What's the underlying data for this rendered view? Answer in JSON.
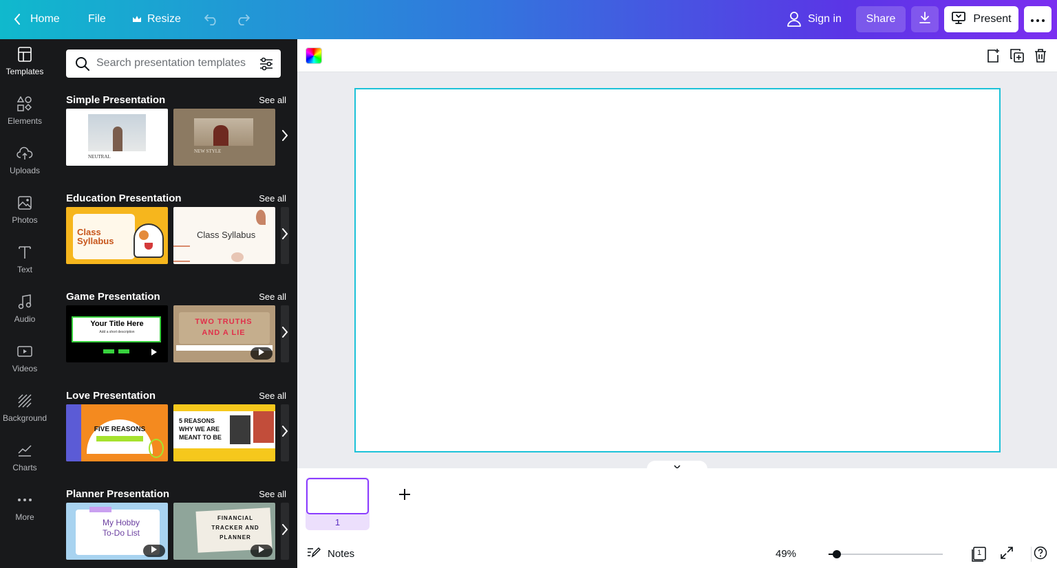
{
  "topbar": {
    "home_label": "Home",
    "file_label": "File",
    "resize_label": "Resize",
    "sign_in_label": "Sign in",
    "share_label": "Share",
    "present_label": "Present"
  },
  "rail": {
    "items": [
      {
        "label": "Templates",
        "icon": "templates-icon",
        "active": true
      },
      {
        "label": "Elements",
        "icon": "elements-icon"
      },
      {
        "label": "Uploads",
        "icon": "cloud-upload-icon"
      },
      {
        "label": "Photos",
        "icon": "image-icon"
      },
      {
        "label": "Text",
        "icon": "text-icon"
      },
      {
        "label": "Audio",
        "icon": "music-note-icon"
      },
      {
        "label": "Videos",
        "icon": "video-icon"
      },
      {
        "label": "Background",
        "icon": "pattern-icon"
      },
      {
        "label": "Charts",
        "icon": "line-chart-icon"
      },
      {
        "label": "More",
        "icon": "more-dots-icon"
      }
    ]
  },
  "search": {
    "placeholder": "Search presentation templates",
    "value": ""
  },
  "sections": [
    {
      "title": "Simple Presentation",
      "see_all": "See all",
      "templates": [
        {
          "text": "NEUTRAL"
        },
        {
          "text": "NEW STYLE"
        }
      ]
    },
    {
      "title": "Education Presentation",
      "see_all": "See all",
      "templates": [
        {
          "text": "Class Syllabus"
        },
        {
          "text": "Class Syllabus"
        }
      ]
    },
    {
      "title": "Game Presentation",
      "see_all": "See all",
      "templates": [
        {
          "text": "Your Title Here",
          "sub": "Add a short description"
        },
        {
          "text": "TWO TRUTHS AND A LIE"
        }
      ]
    },
    {
      "title": "Love Presentation",
      "see_all": "See all",
      "templates": [
        {
          "text": "FIVE REASONS"
        },
        {
          "text": "5 REASONS WHY WE ARE MEANT TO BE"
        }
      ]
    },
    {
      "title": "Planner Presentation",
      "see_all": "See all",
      "templates": [
        {
          "text": "My Hobby To-Do List"
        },
        {
          "text": "FINANCIAL TRACKER AND PLANNER"
        }
      ]
    }
  ],
  "pages": {
    "current_page": "1"
  },
  "footer": {
    "notes_label": "Notes",
    "zoom": "49%",
    "page_count": "1"
  },
  "colors": {
    "slide_border": "#1cc2d8",
    "page_selected": "#8b3dff",
    "panel_bg": "#18191b"
  }
}
